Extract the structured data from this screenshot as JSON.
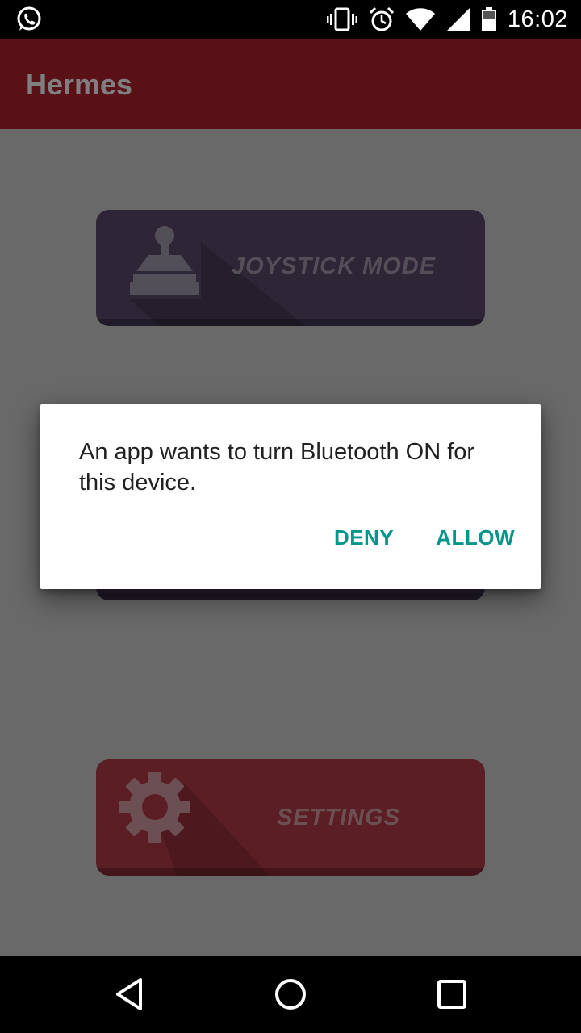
{
  "status_bar": {
    "time": "16:02",
    "icons": [
      "whatsapp-icon",
      "vibrate-icon",
      "alarm-icon",
      "wifi-icon",
      "signal-icon",
      "battery-icon"
    ]
  },
  "app_bar": {
    "title": "Hermes",
    "color": "#b3222f"
  },
  "main": {
    "buttons": [
      {
        "label": "JOYSTICK MODE",
        "icon": "joystick-icon",
        "color": "#5c4a6e"
      },
      {
        "label": "",
        "icon": "",
        "color": "#5c4a6e"
      },
      {
        "label": "SETTINGS",
        "icon": "gear-icon",
        "color": "#b63d48"
      }
    ]
  },
  "dialog": {
    "message": "An app wants to turn Bluetooth ON for this device.",
    "deny_label": "DENY",
    "allow_label": "ALLOW",
    "accent": "#00968a"
  },
  "nav_bar": {
    "icons": [
      "back-icon",
      "home-icon",
      "recents-icon"
    ]
  }
}
